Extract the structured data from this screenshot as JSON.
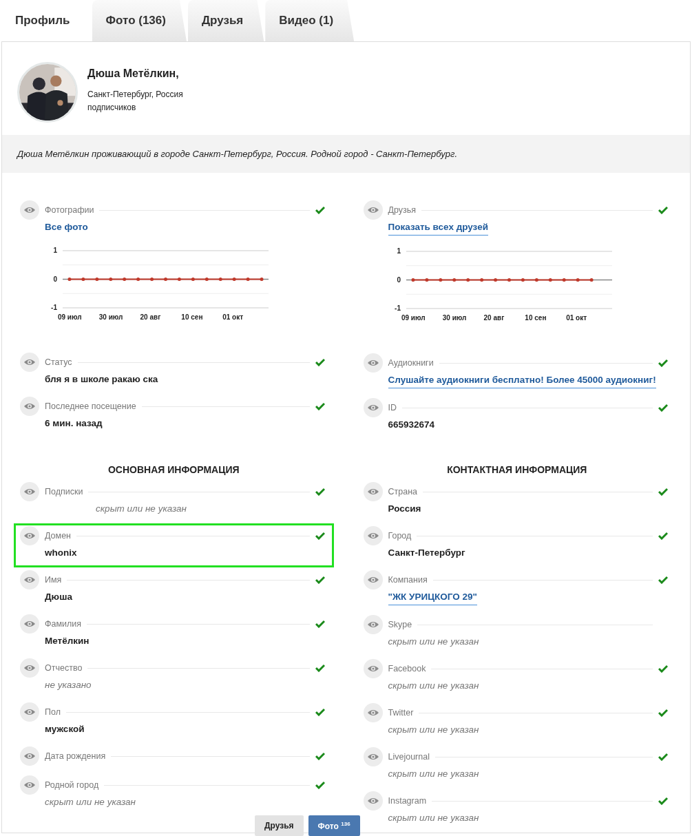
{
  "tabs": [
    {
      "label": "Профиль",
      "selected": true
    },
    {
      "label": "Фото (136)",
      "selected": false
    },
    {
      "label": "Друзья",
      "selected": false
    },
    {
      "label": "Видео (1)",
      "selected": false
    }
  ],
  "profile": {
    "name": "Дюша Метёлкин,",
    "location": "Санкт-Петербург, Россия",
    "followers": "подписчиков"
  },
  "about": "Дюша Метёлкин проживающий в городе Санкт-Петербург, Россия. Родной город - Санкт-Петербург.",
  "overview": [
    {
      "rows": [
        {
          "label": "Фотографии",
          "value": "Все фото",
          "kind": "link",
          "checked": true,
          "chart_data": {
            "type": "line",
            "categories": [
              "09 июл",
              null,
              null,
              "30 июл",
              null,
              null,
              "20 авг",
              null,
              null,
              "10 сен",
              null,
              null,
              "01 окт",
              null,
              null
            ],
            "ylim": [
              -1,
              1
            ],
            "yticks": [
              -1,
              0,
              1
            ],
            "ref_lines": [
              {
                "axis": "y",
                "value": -0.5
              },
              {
                "axis": "y",
                "value": 0.5
              }
            ],
            "series": [
              {
                "color": "#c0392b",
                "values": [
                  0,
                  0,
                  0,
                  0,
                  0,
                  0,
                  0,
                  0,
                  0,
                  0,
                  0,
                  0,
                  0,
                  0,
                  0
                ]
              }
            ]
          }
        },
        {
          "label": "Статус",
          "value": "бля я в школе ракаю ска",
          "kind": "text",
          "checked": true
        },
        {
          "label": "Последнее посещение",
          "value": "6 мин. назад",
          "kind": "text",
          "checked": true
        }
      ]
    },
    {
      "rows": [
        {
          "label": "Друзья",
          "value": "Показать всех друзей",
          "kind": "underlined-link",
          "checked": true,
          "chart_data": {
            "type": "line",
            "categories": [
              "09 июл",
              null,
              null,
              "30 июл",
              null,
              null,
              "20 авг",
              null,
              null,
              "10 сен",
              null,
              null,
              "01 окт",
              null,
              null
            ],
            "ylim": [
              -1,
              1
            ],
            "yticks": [
              -1,
              0,
              1
            ],
            "ref_lines": [
              {
                "axis": "y",
                "value": -0.5
              },
              {
                "axis": "y",
                "value": 0.5
              }
            ],
            "series": [
              {
                "color": "#c0392b",
                "values": [
                  0,
                  0,
                  0,
                  0,
                  0,
                  0,
                  0,
                  0,
                  0,
                  0,
                  0,
                  0,
                  0,
                  0,
                  null
                ]
              }
            ]
          }
        },
        {
          "label": "Аудиокниги",
          "value": "Слушайте аудиокниги бесплатно! Более 45000 аудиокниг!",
          "kind": "underlined-link",
          "checked": true
        },
        {
          "label": "ID",
          "value": "665932674",
          "kind": "text",
          "checked": true
        }
      ]
    }
  ],
  "sections": [
    {
      "heading": "ОСНОВНАЯ ИНФОРМАЦИЯ",
      "rows": [
        {
          "label": "Подписки",
          "value": "скрыт или не указан",
          "kind": "muted-indented",
          "checked": true,
          "highlighted": false
        },
        {
          "label": "Домен",
          "value": "whonix",
          "kind": "text",
          "checked": true,
          "highlighted": true
        },
        {
          "label": "Имя",
          "value": "Дюша",
          "kind": "text",
          "checked": true,
          "highlighted": false
        },
        {
          "label": "Фамилия",
          "value": "Метёлкин",
          "kind": "text",
          "checked": true,
          "highlighted": false
        },
        {
          "label": "Отчество",
          "value": "не указано",
          "kind": "muted",
          "checked": true,
          "highlighted": false
        },
        {
          "label": "Пол",
          "value": "мужской",
          "kind": "text",
          "checked": true,
          "highlighted": false
        },
        {
          "label": "Дата рождения",
          "checked": true,
          "highlighted": false
        },
        {
          "label": "Родной город",
          "value": "скрыт или не указан",
          "kind": "muted",
          "checked": true,
          "highlighted": false
        }
      ]
    },
    {
      "heading": "КОНТАКТНАЯ ИНФОРМАЦИЯ",
      "rows": [
        {
          "label": "Страна",
          "value": "Россия",
          "kind": "text",
          "checked": true,
          "highlighted": false
        },
        {
          "label": "Город",
          "value": "Санкт-Петербург",
          "kind": "text",
          "checked": true,
          "highlighted": false
        },
        {
          "label": "Компания",
          "value": "\"ЖК УРИЦКОГО 29\"",
          "kind": "underlined-link",
          "checked": true,
          "highlighted": false
        },
        {
          "label": "Skype",
          "value": "скрыт или не указан",
          "kind": "muted",
          "checked": false,
          "highlighted": false
        },
        {
          "label": "Facebook",
          "value": "скрыт или не указан",
          "kind": "muted",
          "checked": true,
          "highlighted": false
        },
        {
          "label": "Twitter",
          "value": "скрыт или не указан",
          "kind": "muted",
          "checked": true,
          "highlighted": false
        },
        {
          "label": "Livejournal",
          "value": "скрыт или не указан",
          "kind": "muted",
          "checked": true,
          "highlighted": false
        },
        {
          "label": "Instagram",
          "value": "скрыт или не указан",
          "kind": "muted",
          "checked": true,
          "highlighted": false
        }
      ]
    }
  ],
  "floating_buttons": [
    {
      "label": "Друзья",
      "kind": "secondary"
    },
    {
      "label": "Фото",
      "count": "136",
      "kind": "primary"
    }
  ]
}
